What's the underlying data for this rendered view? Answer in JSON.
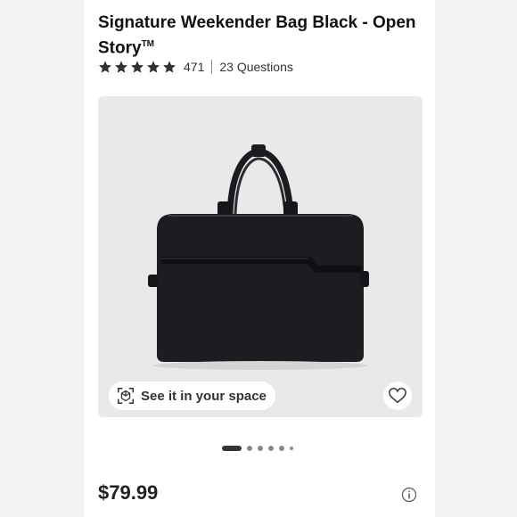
{
  "product": {
    "title": "Signature Weekender Bag Black - Open Story",
    "trademark": "TM",
    "rating_stars": 5,
    "review_count": "471",
    "questions": "23 Questions",
    "price": "$79.99"
  },
  "photo": {
    "ar_label": "See it in your space",
    "carousel_pages": 6,
    "active_page": 1
  },
  "icons": {
    "star": "star-icon",
    "ar": "view-in-space-icon",
    "favorite": "heart-icon",
    "info": "info-icon"
  },
  "colors": {
    "page_bg": "#f3f3f3",
    "star": "#333333",
    "bag": "#1c1d21"
  }
}
